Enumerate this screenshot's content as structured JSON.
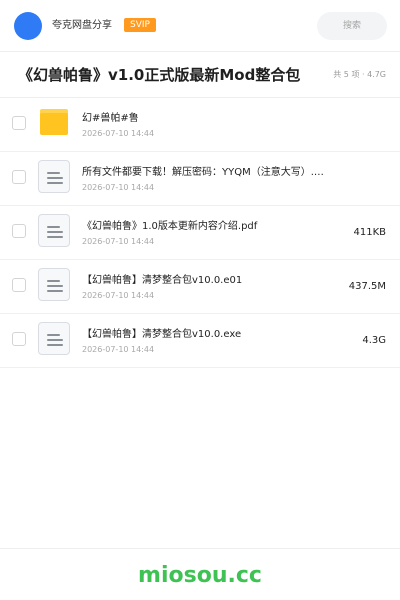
{
  "header": {
    "share_name": "夸克网盘分享",
    "badge": "SVIP",
    "search_placeholder": "搜索",
    "avatar_color": "#2f7bf5"
  },
  "share": {
    "title": "《幻兽帕鲁》v1.0正式版最新Mod整合包",
    "meta": "共 5 项 · 4.7G"
  },
  "files": [
    {
      "type": "folder-icon",
      "name": "幻#兽帕#鲁",
      "date": "2026-07-10 14:44",
      "size": ""
    },
    {
      "type": "document-icon",
      "name": "所有文件都要下载！解压密码：YYQM（注意大写）.…",
      "date": "2026-07-10 14:44",
      "size": ""
    },
    {
      "type": "document-icon",
      "name": "《幻兽帕鲁》1.0版本更新内容介绍.pdf",
      "date": "2026-07-10 14:44",
      "size": "411KB"
    },
    {
      "type": "document-icon",
      "name": "【幻兽帕鲁】清梦整合包v10.0.e01",
      "date": "2026-07-10 14:44",
      "size": "437.5M"
    },
    {
      "type": "document-icon",
      "name": "【幻兽帕鲁】清梦整合包v10.0.exe",
      "date": "2026-07-10 14:44",
      "size": "4.3G"
    }
  ],
  "footer": {
    "brand": "miosou.cc",
    "brand_color": "#3ec253"
  }
}
